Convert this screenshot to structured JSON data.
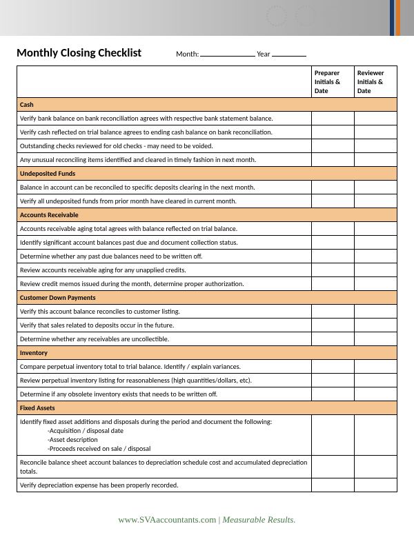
{
  "title": "Monthly Closing Checklist",
  "month_label": "Month:",
  "year_label": "Year",
  "columns": {
    "preparer": "Preparer Initials & Date",
    "reviewer": "Reviewer Initials & Date"
  },
  "sections": [
    {
      "name": "Cash",
      "items": [
        "Verify bank balance on bank reconciliation agrees with respective bank statement balance.",
        "Verify cash reflected on trial balance agrees to ending cash balance on bank reconciliation.",
        "Outstanding checks reviewed for old checks - may need to be voided.",
        "Any unusual reconciling items identified and cleared in timely fashion in next month."
      ]
    },
    {
      "name": "Undeposited Funds",
      "items": [
        "Balance in account can be reconciled to specific deposits clearing in the next month.",
        "Verify all undeposited funds from prior month have cleared in current month."
      ]
    },
    {
      "name": "Accounts Receivable",
      "items": [
        "Accounts receivable aging total agrees with balance reflected on trial balance.",
        "Identify significant account balances past due and document collection status.",
        "Determine whether any past due balances need to be written off.",
        "Review accounts receivable aging for any unapplied credits.",
        "Review credit memos issued during the month, determine proper authorization."
      ]
    },
    {
      "name": "Customer Down Payments",
      "items": [
        "Verify this account balance reconciles to customer listing.",
        "Verify that sales related to deposits occur in the future.",
        "Determine whether any receivables are uncollectible."
      ]
    },
    {
      "name": "Inventory",
      "items": [
        "Compare perpetual inventory total to trial balance.  Identify / explain variances.",
        "Review perpetual inventory listing for reasonableness (high quantities/dollars, etc).",
        "Determine if any obsolete inventory exists that needs to be written off."
      ]
    },
    {
      "name": "Fixed Assets",
      "items": [
        "Identify fixed asset additions and disposals during the period and document the following:\n-Acquisition / disposal date\n-Asset description\n-Proceeds received on sale / disposal",
        "Reconcile balance sheet account balances to depreciation schedule cost and accumulated depreciation totals.",
        "Verify depreciation expense has been properly recorded."
      ]
    }
  ],
  "footer": {
    "site": "www.SVAaccountants.com",
    "separator": " | ",
    "slogan": "Measurable Results."
  }
}
